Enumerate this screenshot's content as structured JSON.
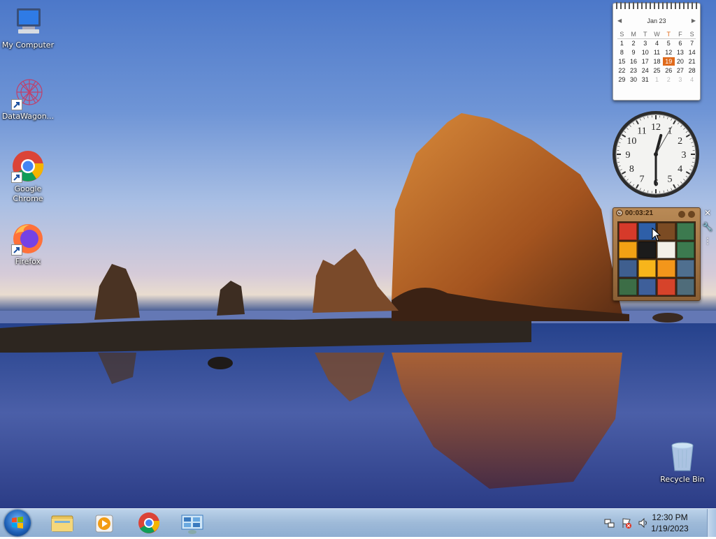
{
  "desktop": {
    "icons": [
      {
        "label": "My Computer",
        "icon": "computer-icon"
      },
      {
        "label": "DataWagon...",
        "icon": "datawagon-icon"
      },
      {
        "label": "Google\nChrome",
        "icon": "chrome-icon"
      },
      {
        "label": "Firefox",
        "icon": "firefox-icon"
      },
      {
        "label": "Recycle Bin",
        "icon": "recycle-bin-icon"
      }
    ]
  },
  "calendar": {
    "month": "Jan 23",
    "weekdays": [
      "S",
      "M",
      "T",
      "W",
      "T",
      "F",
      "S"
    ],
    "today_weekday_index": 4,
    "selected_day": "19",
    "weeks": [
      [
        "1",
        "2",
        "3",
        "4",
        "5",
        "6",
        "7"
      ],
      [
        "8",
        "9",
        "10",
        "11",
        "12",
        "13",
        "14"
      ],
      [
        "15",
        "16",
        "17",
        "18",
        "19",
        "20",
        "21"
      ],
      [
        "22",
        "23",
        "24",
        "25",
        "26",
        "27",
        "28"
      ],
      [
        "29",
        "30",
        "31",
        "1",
        "2",
        "3",
        "4"
      ]
    ],
    "next_month_days_count": 4,
    "accent": "#e06a1b"
  },
  "clock": {
    "numerals": [
      "12",
      "1",
      "2",
      "3",
      "4",
      "5",
      "6",
      "7",
      "8",
      "9",
      "10",
      "11"
    ],
    "hour": 12,
    "minute": 30,
    "second": 5
  },
  "puzzle": {
    "timer": "00:03:21",
    "tile_colors": [
      "#d63a2a",
      "#2e5fa8",
      "#7b4b23",
      "#3c7a4f",
      "#f2a114",
      "#1b1b1b",
      "#f3f0e8",
      "#3c7a4f",
      "#3f5f8f",
      "#f7b51b",
      "#f3961b",
      "#4f6f8f",
      "#3c6d46",
      "#3e5f9a",
      "#d6432a",
      "#4f6c7a"
    ]
  },
  "gadget_controls": {
    "close": "✕",
    "options": "🔧",
    "drag": "⋮"
  },
  "taskbar": {
    "pinned": [
      "file-explorer-icon",
      "media-player-icon",
      "chrome-icon",
      "control-panel-icon"
    ],
    "clock_time": "12:30 PM",
    "clock_date": "1/19/2023",
    "tray_icons": [
      "network-icon",
      "action-center-flag-icon",
      "volume-icon"
    ]
  }
}
